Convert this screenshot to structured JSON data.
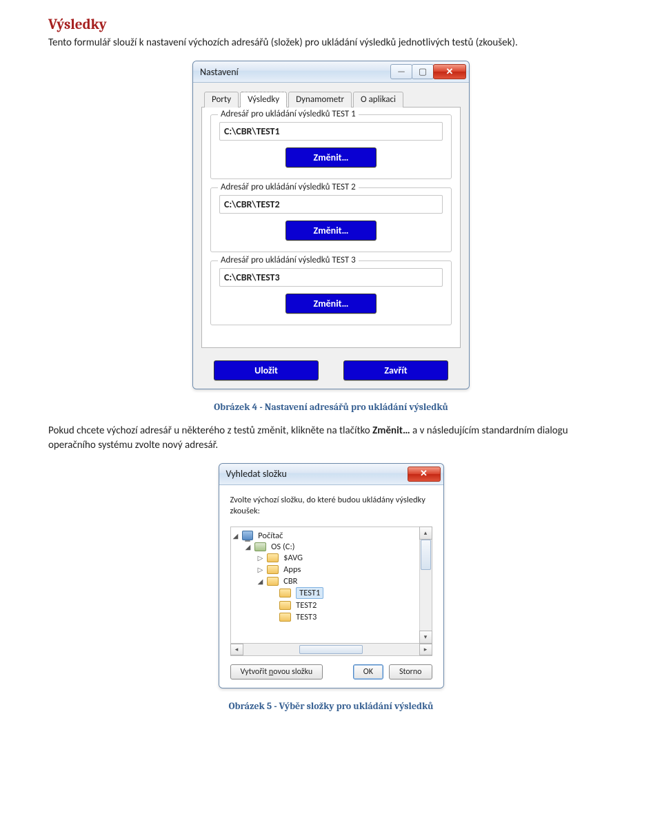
{
  "doc": {
    "section_title": "Výsledky",
    "intro": "Tento formulář slouží k nastavení výchozích adresářů (složek) pro ukládání výsledků jednotlivých testů (zkoušek).",
    "caption1": "Obrázek 4 - Nastavení adresářů pro ukládání výsledků",
    "para2_pre": "Pokud chcete výchozí adresář u některého z testů změnit, klikněte na tlačítko ",
    "para2_bold": "Změnit…",
    "para2_post": " a v následujícím standardním dialogu operačního systému zvolte nový adresář.",
    "caption2": "Obrázek 5 - Výběr složky pro ukládání výsledků"
  },
  "settings_dialog": {
    "title": "Nastavení",
    "tabs": [
      "Porty",
      "Výsledky",
      "Dynamometr",
      "O aplikaci"
    ],
    "active_tab_index": 1,
    "groups": [
      {
        "label": "Adresář pro ukládání výsledků TEST 1",
        "path": "C:\\CBR\\TEST1",
        "button": "Změnit…"
      },
      {
        "label": "Adresář pro ukládání výsledků TEST 2",
        "path": "C:\\CBR\\TEST2",
        "button": "Změnit…"
      },
      {
        "label": "Adresář pro ukládání výsledků TEST 3",
        "path": "C:\\CBR\\TEST3",
        "button": "Změnit…"
      }
    ],
    "save_button": "Uložit",
    "close_button": "Zavřít",
    "minimize_glyph": "—",
    "maximize_glyph": "▢",
    "close_glyph": "✕"
  },
  "browse_dialog": {
    "title": "Vyhledat složku",
    "prompt": "Zvolte výchozí složku, do které budou ukládány výsledky zkoušek:",
    "tree": {
      "root": "Počítač",
      "drive": "OS (C:)",
      "folders_level1": [
        "$AVG",
        "Apps",
        "CBR"
      ],
      "cbr_children": [
        "TEST1",
        "TEST2",
        "TEST3"
      ],
      "selected": "TEST1",
      "expander_open": "◢",
      "expander_closed": "▷"
    },
    "new_folder_btn": "Vytvořit novou složku",
    "new_folder_accel": "n",
    "ok_btn": "OK",
    "cancel_btn": "Storno",
    "close_glyph": "✕"
  }
}
